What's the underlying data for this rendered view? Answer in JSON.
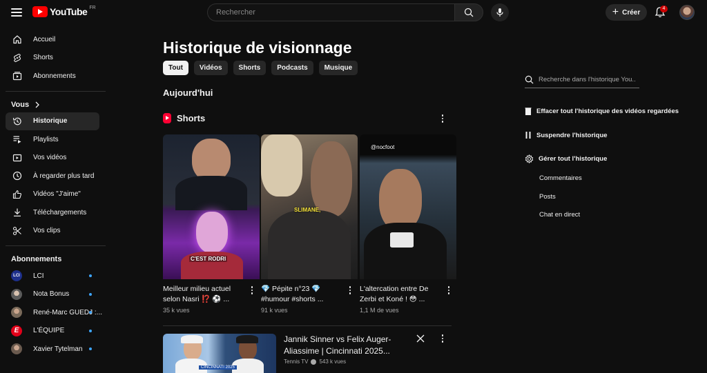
{
  "header": {
    "logo_text": "YouTube",
    "region": "FR",
    "search_placeholder": "Rechercher",
    "create_label": "Créer",
    "notifications_count": "4"
  },
  "sidebar": {
    "main": [
      {
        "label": "Accueil",
        "icon": "home-icon"
      },
      {
        "label": "Shorts",
        "icon": "shorts-icon"
      },
      {
        "label": "Abonnements",
        "icon": "subscriptions-icon"
      }
    ],
    "you_heading": "Vous",
    "you": [
      {
        "label": "Historique",
        "icon": "history-icon",
        "active": true
      },
      {
        "label": "Playlists",
        "icon": "playlists-icon"
      },
      {
        "label": "Vos vidéos",
        "icon": "your-videos-icon"
      },
      {
        "label": "À regarder plus tard",
        "icon": "watch-later-icon"
      },
      {
        "label": "Vidéos \"J'aime\"",
        "icon": "like-icon"
      },
      {
        "label": "Téléchargements",
        "icon": "download-icon"
      },
      {
        "label": "Vos clips",
        "icon": "clips-icon"
      }
    ],
    "subs_heading": "Abonnements",
    "subscriptions": [
      {
        "label": "LCI",
        "color": "#1d2f8a"
      },
      {
        "label": "Nota Bonus",
        "color": "#5b5b5b"
      },
      {
        "label": "René-Marc GUEDJ :...",
        "color": "#7a6a5a"
      },
      {
        "label": "L'ÉQUIPE",
        "color": "#e2001a"
      },
      {
        "label": "Xavier Tytelman",
        "color": "#6a5a4e"
      }
    ]
  },
  "main": {
    "title": "Historique de visionnage",
    "chips": [
      "Tout",
      "Vidéos",
      "Shorts",
      "Podcasts",
      "Musique"
    ],
    "date_heading": "Aujourd'hui",
    "shorts_heading": "Shorts",
    "shorts": [
      {
        "title": "Meilleur milieu actuel selon Nasri ⁉️ ⚽ ...",
        "views": "35 k vues",
        "overlay": "C'EST RODRI"
      },
      {
        "title": "💎 Pépite n°23 💎 #humour #shorts ...",
        "views": "91 k vues",
        "overlay": "SLIMANE,"
      },
      {
        "title": "L'altercation entre De Zerbi et Koné ! 😳 ...",
        "views": "1,1 M de vues",
        "overlay": "@nocfoot"
      }
    ],
    "video": {
      "title": "Jannik Sinner vs Felix Auger-Aliassime | Cincinnati 2025...",
      "channel": "Tennis TV",
      "views": "543 k vues",
      "thumb_tag": "CINCINNATI 2025"
    }
  },
  "right_panel": {
    "search_placeholder": "Recherche dans l'historique You...",
    "clear_label": "Effacer tout l'historique des vidéos regardées",
    "pause_label": "Suspendre l'historique",
    "manage_label": "Gérer tout l'historique",
    "sub_links": [
      "Commentaires",
      "Posts",
      "Chat en direct"
    ]
  }
}
